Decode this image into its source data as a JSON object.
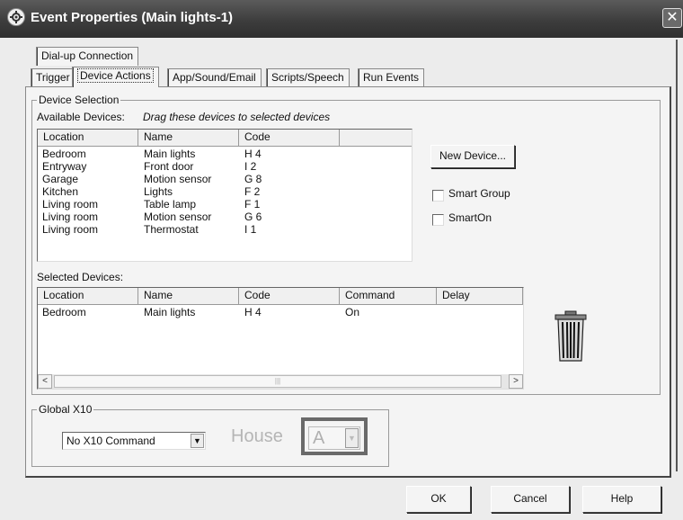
{
  "window": {
    "title": "Event Properties (Main lights-1)",
    "close_glyph": "✕"
  },
  "tabs": {
    "row1": [
      {
        "label": "Dial-up Connection"
      }
    ],
    "row2": [
      {
        "label": "Trigger"
      },
      {
        "label": "Device Actions",
        "active": true
      },
      {
        "label": "App/Sound/Email"
      },
      {
        "label": "Scripts/Speech"
      },
      {
        "label": "Run Events"
      }
    ]
  },
  "device_selection": {
    "group_label": "Device Selection",
    "available_label": "Available Devices:",
    "drag_hint": "Drag these devices to selected devices",
    "available_columns": [
      "Location",
      "Name",
      "Code",
      ""
    ],
    "available_rows": [
      [
        "Bedroom",
        "Main lights",
        "H 4"
      ],
      [
        "Entryway",
        "Front door",
        "I 2"
      ],
      [
        "Garage",
        "Motion sensor",
        "G 8"
      ],
      [
        "Kitchen",
        "Lights",
        "F 2"
      ],
      [
        "Living room",
        "Table lamp",
        "F 1"
      ],
      [
        "Living room",
        "Motion sensor",
        "G 6"
      ],
      [
        "Living room",
        "Thermostat",
        "I 1"
      ]
    ],
    "new_device_button": "New Device...",
    "smart_group_label": "Smart Group",
    "smart_on_label": "SmartOn",
    "selected_label": "Selected Devices:",
    "selected_columns": [
      "Location",
      "Name",
      "Code",
      "Command",
      "Delay"
    ],
    "selected_rows": [
      [
        "Bedroom",
        "Main lights",
        "H 4",
        "On",
        ""
      ]
    ],
    "scroll_left": "<",
    "scroll_right": ">",
    "scroll_grip": "|||"
  },
  "global_x10": {
    "group_label": "Global X10",
    "command_value": "No X10 Command",
    "house_label": "House",
    "house_value": "A"
  },
  "footer": {
    "ok": "OK",
    "cancel": "Cancel",
    "help": "Help"
  },
  "icons": {
    "title": "gear-icon",
    "trash": "trash-can-icon",
    "dropdown": "chevron-down-icon"
  }
}
